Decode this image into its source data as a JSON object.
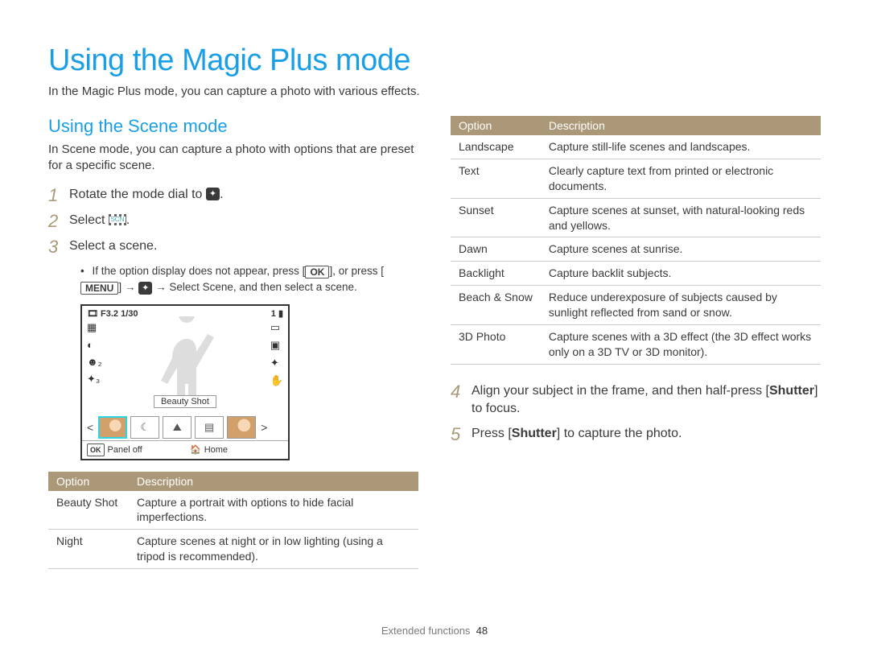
{
  "page": {
    "title": "Using the Magic Plus mode",
    "intro": "In the Magic Plus mode, you can capture a photo with various effects."
  },
  "section": {
    "title": "Using the Scene mode",
    "intro": "In Scene mode, you can capture a photo with options that are preset for a specific scene."
  },
  "steps": {
    "s1_num": "1",
    "s1_pre": "Rotate the mode dial to ",
    "s1_post": ".",
    "s2_num": "2",
    "s2_pre": "Select ",
    "s2_post": ".",
    "s3_num": "3",
    "s3_text": "Select a scene.",
    "s3_note_a": "If the option display does not appear, press [",
    "s3_ok": "OK",
    "s3_note_b": "], or press [",
    "s3_menu": "MENU",
    "s3_note_c": "] → ",
    "s3_note_d": " → ",
    "s3_select_scene": "Select Scene",
    "s3_note_e": ", and then select a scene.",
    "s4_num": "4",
    "s4_a": "Align your subject in the frame, and then half-press [",
    "s4_shutter": "Shutter",
    "s4_b": "] to focus.",
    "s5_num": "5",
    "s5_a": "Press [",
    "s5_shutter": "Shutter",
    "s5_b": "] to capture the photo."
  },
  "lcd": {
    "exposure": "F3.2 1/30",
    "battery": "1",
    "beauty_label": "Beauty Shot",
    "panel_off": "Panel off",
    "home": "Home",
    "scn_label": "SCN"
  },
  "table_headers": {
    "option": "Option",
    "description": "Description"
  },
  "table1": [
    {
      "opt": "Beauty Shot",
      "desc": "Capture a portrait with options to hide facial imperfections."
    },
    {
      "opt": "Night",
      "desc": "Capture scenes at night or in low lighting (using a tripod is recommended)."
    }
  ],
  "table2": [
    {
      "opt": "Landscape",
      "desc": "Capture still-life scenes and landscapes."
    },
    {
      "opt": "Text",
      "desc": "Clearly capture text from printed or electronic documents."
    },
    {
      "opt": "Sunset",
      "desc": "Capture scenes at sunset, with natural-looking reds and yellows."
    },
    {
      "opt": "Dawn",
      "desc": "Capture scenes at sunrise."
    },
    {
      "opt": "Backlight",
      "desc": "Capture backlit subjects."
    },
    {
      "opt": "Beach & Snow",
      "desc": "Reduce underexposure of subjects caused by sunlight reflected from sand or snow."
    },
    {
      "opt": "3D Photo",
      "desc": "Capture scenes with a 3D effect (the 3D effect works only on a 3D TV or 3D monitor)."
    }
  ],
  "footer": {
    "section": "Extended functions",
    "page": "48"
  }
}
